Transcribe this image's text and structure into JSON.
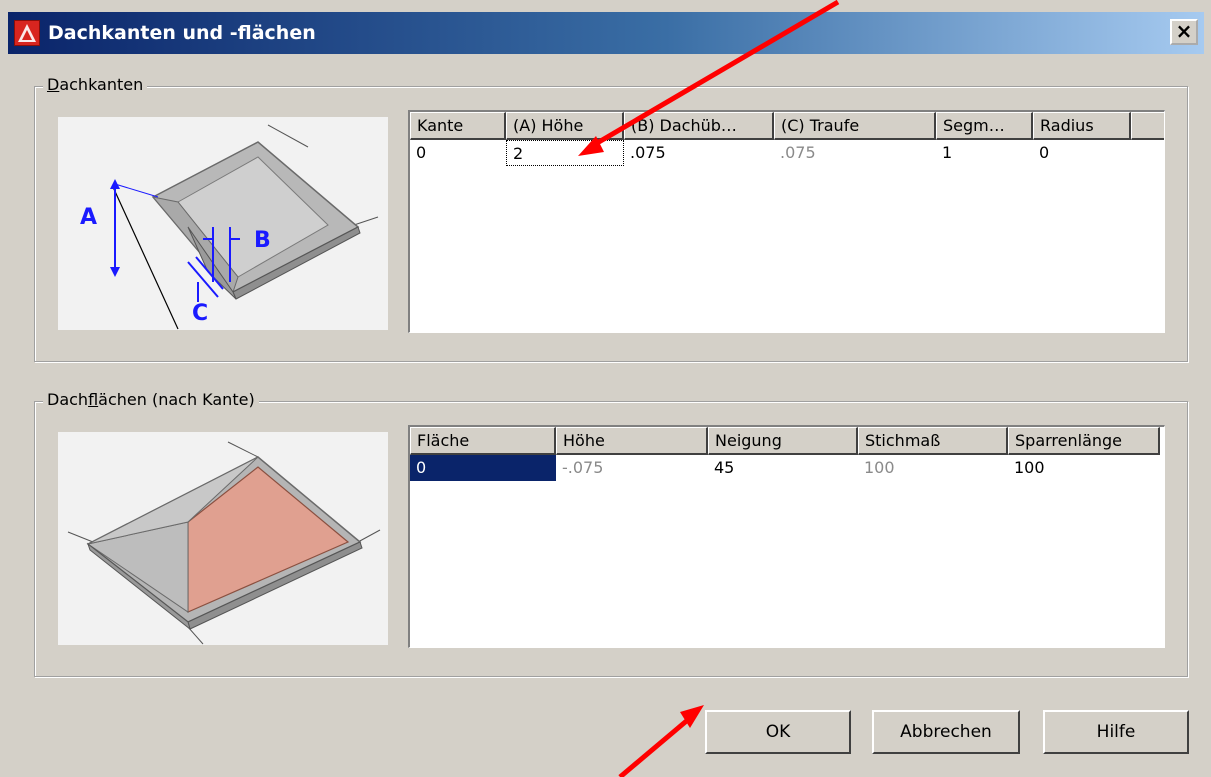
{
  "window": {
    "title": "Dachkanten und -flächen",
    "close_glyph": "×"
  },
  "edges_group": {
    "label_first": "D",
    "label_rest": "achkanten",
    "columns": [
      "Kante",
      "(A) Höhe",
      "(B) Dachüb…",
      "(C) Traufe",
      "Segm…",
      "Radius"
    ],
    "row": [
      "0",
      "2",
      ".075",
      ".075",
      "1",
      "0"
    ],
    "diagram_labels": {
      "a": "A",
      "b": "B",
      "c": "C"
    }
  },
  "faces_group": {
    "label_start": "Dach",
    "label_underlined": "f",
    "label_end": "lächen (nach Kante)",
    "columns": [
      "Fläche",
      "Höhe",
      "Neigung",
      "Stichmaß",
      "Sparrenlänge"
    ],
    "row": [
      "0",
      "-.075",
      "45",
      "100",
      "100"
    ]
  },
  "buttons": {
    "ok": "OK",
    "cancel": "Abbrechen",
    "help": "Hilfe"
  },
  "colors": {
    "annotation_arrow": "#ff0000",
    "selection": "#0a246a"
  },
  "icons": {
    "app": "autocad-icon",
    "close": "close-icon"
  }
}
